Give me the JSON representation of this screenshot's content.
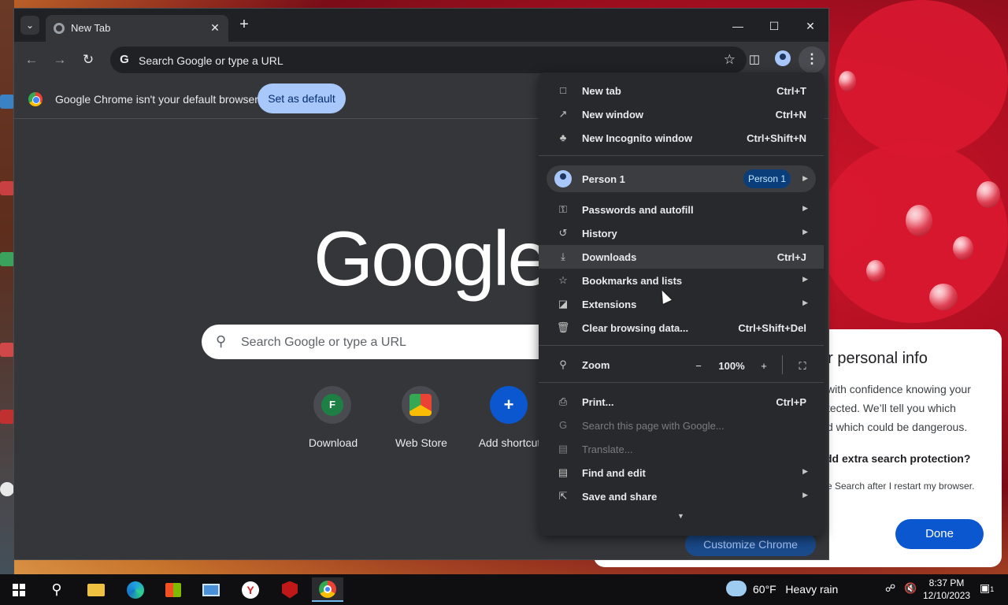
{
  "browser": {
    "tab": {
      "title": "New Tab"
    },
    "omnibox": {
      "placeholder": "Search Google or type a URL"
    },
    "infobar": {
      "message": "Google Chrome isn't your default browser",
      "button": "Set as default"
    },
    "ntp": {
      "logo": "Google",
      "search_placeholder": "Search Google or type a URL",
      "shortcuts": [
        {
          "label": "Download",
          "initial": "F"
        },
        {
          "label": "Web Store",
          "initial": ""
        },
        {
          "label": "Add shortcut",
          "initial": "+"
        }
      ],
      "customize": "Customize Chrome"
    }
  },
  "menu": {
    "items_top": [
      {
        "label": "New tab",
        "shortcut": "Ctrl+T",
        "icon": "tab-icon"
      },
      {
        "label": "New window",
        "shortcut": "Ctrl+N",
        "icon": "window-icon"
      },
      {
        "label": "New Incognito window",
        "shortcut": "Ctrl+Shift+N",
        "icon": "incognito-icon"
      }
    ],
    "profile": {
      "label": "Person 1",
      "badge": "Person 1"
    },
    "items_mid": [
      {
        "label": "Passwords and autofill",
        "icon": "key-icon"
      },
      {
        "label": "History",
        "icon": "history-icon"
      },
      {
        "label": "Downloads",
        "shortcut": "Ctrl+J",
        "icon": "download-icon"
      },
      {
        "label": "Bookmarks and lists",
        "icon": "star-icon"
      },
      {
        "label": "Extensions",
        "icon": "extension-icon"
      },
      {
        "label": "Clear browsing data...",
        "shortcut": "Ctrl+Shift+Del",
        "icon": "trash-icon"
      }
    ],
    "zoom": {
      "label": "Zoom",
      "value": "100%"
    },
    "items_bottom": [
      {
        "label": "Print...",
        "shortcut": "Ctrl+P",
        "icon": "print-icon"
      },
      {
        "label": "Search this page with Google...",
        "icon": "google-icon",
        "disabled": true
      },
      {
        "label": "Translate...",
        "icon": "translate-icon",
        "disabled": true
      },
      {
        "label": "Find and edit",
        "icon": "find-icon"
      },
      {
        "label": "Save and share",
        "icon": "share-icon"
      }
    ]
  },
  "privacy_card": {
    "title": "ur personal info",
    "lines": [
      "with confidence knowing your",
      "tected. We’ll tell you which",
      "d which could be dangerous."
    ],
    "question": "dd extra search protection?",
    "small": "e Search after I restart my browser.",
    "done": "Done"
  },
  "taskbar": {
    "weather": {
      "temp": "60°F",
      "condition": "Heavy rain"
    },
    "time": "8:37 PM",
    "date": "12/10/2023",
    "notifications": "1"
  },
  "colors": {
    "menu_bg": "#28292c",
    "accent": "#a8c7fa",
    "done_button": "#0b57d0"
  }
}
